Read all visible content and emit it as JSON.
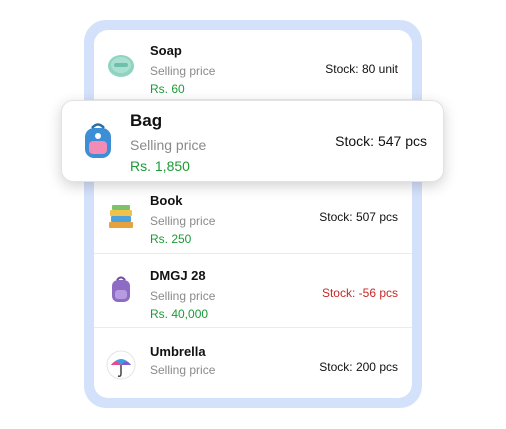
{
  "products": [
    {
      "name": "Soap",
      "subtitle": "Selling price",
      "price": "Rs. 60",
      "stock": "Stock: 80 unit",
      "icon": "soap-icon",
      "stock_color": "#111111"
    },
    {
      "name": "Bag",
      "subtitle": "Selling price",
      "price": "Rs. 1,850",
      "stock": "Stock: 547 pcs",
      "icon": "backpack-icon",
      "stock_color": "#111111"
    },
    {
      "name": "Book",
      "subtitle": "Selling price",
      "price": "Rs. 250",
      "stock": "Stock: 507 pcs",
      "icon": "books-icon",
      "stock_color": "#111111"
    },
    {
      "name": "DMGJ 28",
      "subtitle": "Selling price",
      "price": "Rs. 40,000",
      "stock": "Stock: -56 pcs",
      "icon": "backpack-icon",
      "stock_color": "#c62828"
    },
    {
      "name": "Umbrella",
      "subtitle": "Selling price",
      "stock": "Stock: 200 pcs",
      "icon": "umbrella-icon",
      "stock_color": "#111111"
    }
  ],
  "colors": {
    "frame": "#d4e1fb",
    "price": "#1c9a37",
    "negative_stock": "#c62828",
    "muted": "#8a8a8a"
  }
}
